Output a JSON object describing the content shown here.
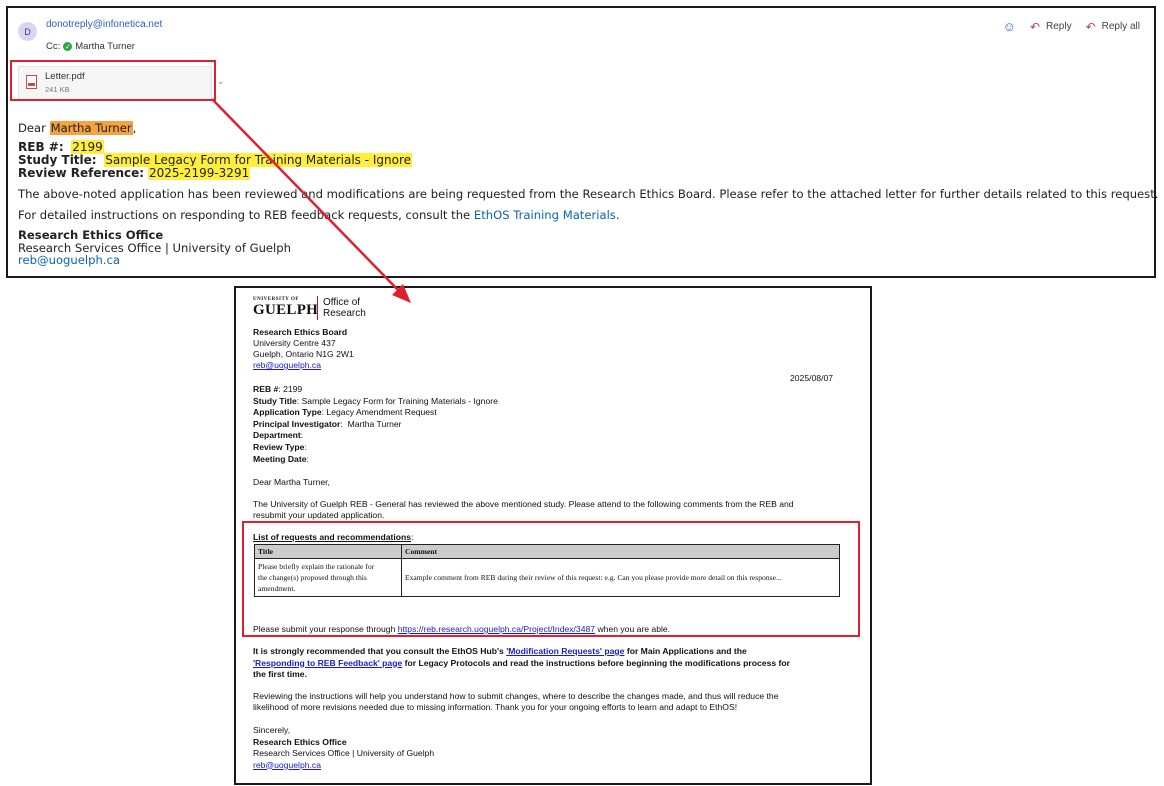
{
  "email": {
    "avatar_letter": "D",
    "sender": "donotreply@infonetica.net",
    "cc_label": "Cc:",
    "cc_name": "Martha Turner",
    "actions": {
      "reply": "Reply",
      "reply_all": "Reply all"
    },
    "attachment": {
      "name": "Letter.pdf",
      "size": "241 KB"
    },
    "greeting": {
      "dear": "Dear",
      "name": "Martha Turner",
      "comma": ","
    },
    "reb": {
      "label": "REB #:",
      "value": "2199"
    },
    "study": {
      "label": "Study Title:",
      "value": "Sample Legacy Form for Training Materials - Ignore"
    },
    "review": {
      "label": "Review Reference:",
      "value": "2025-2199-3291"
    },
    "para1": "The above-noted application has been reviewed and modifications are being requested from the Research Ethics Board. Please refer to the attached letter for further details related to this request.",
    "para2_pre": "For detailed instructions on responding to REB feedback requests, consult the",
    "para2_link": "EthOS Training Materials",
    "para2_post": ".",
    "sig_office": "Research Ethics Office",
    "sig_dept": "Research Services Office | University of Guelph",
    "sig_email": "reb@uoguelph.ca"
  },
  "letter": {
    "logo": {
      "uni": "UNIVERSITY OF",
      "guelph": "GUELPH",
      "office1": "Office of",
      "office2": "Research"
    },
    "board": "Research Ethics Board",
    "addr1": "University Centre 437",
    "addr2": "Guelph, Ontario N1G 2W1",
    "email": "reb@uoguelph.ca",
    "date": "2025/08/07",
    "fields": [
      {
        "label": "REB #",
        "sep": ": ",
        "value": "2199"
      },
      {
        "label": "Study Title",
        "sep": ": ",
        "value": "Sample Legacy Form for Training Materials - Ignore"
      },
      {
        "label": "Application Type",
        "sep": ": ",
        "value": "Legacy Amendment Request"
      },
      {
        "label": "Principal Investigator",
        "sep": ":  ",
        "value": "Martha Turner"
      },
      {
        "label": "Department",
        "sep": ":",
        "value": ""
      },
      {
        "label": "Review Type",
        "sep": ":",
        "value": ""
      },
      {
        "label": "Meeting Date",
        "sep": ":",
        "value": ""
      }
    ],
    "dear": "Dear Martha Turner,",
    "intro1": "The University of Guelph REB - General has reviewed the above mentioned study. Please attend to the following comments from the REB and",
    "intro2": "resubmit your updated application.",
    "list_title": "List of requests and recommendations",
    "list_colon": ":",
    "table": {
      "headers": [
        "Title",
        "Comment"
      ],
      "row": {
        "title_lines": [
          "Please briefly explain the rationale for",
          "the change(s) proposed through this",
          "amendment."
        ],
        "comment": "Example comment from REB during their review of this request: e.g. Can you please provide more detail on this response..."
      }
    },
    "submit_pre": "Please submit your response through",
    "submit_link": "https://reb.research.uoguelph.ca/Project/Index/3487",
    "submit_post": "when you are able.",
    "rec1_pre": "It is strongly recommended that you consult the EthOS Hub's",
    "rec1_link": "'Modification Requests' page",
    "rec1_post": "for Main Applications and the",
    "rec2_link": "'Responding to REB Feedback' page",
    "rec2_post": "for Legacy Protocols and read the instructions before beginning the modifications process for",
    "rec3": "the first time.",
    "review1": "Reviewing the instructions will help you understand how to submit changes, where to describe the changes made, and thus will reduce the",
    "review2": "likelihood of more revisions needed due to missing information. Thank you for your ongoing efforts to learn and adapt to EthOS!",
    "sincerely": "Sincerely,",
    "sig_office": "Research Ethics Office",
    "sig_dept": "Research Services Office | University of Guelph",
    "sig_email": "reb@uoguelph.ca"
  },
  "colors": {
    "highlight_orange": "#f4a340",
    "highlight_yellow": "#ffef3c",
    "callout_red": "#e0202f",
    "link_blue": "#0b64b4"
  }
}
